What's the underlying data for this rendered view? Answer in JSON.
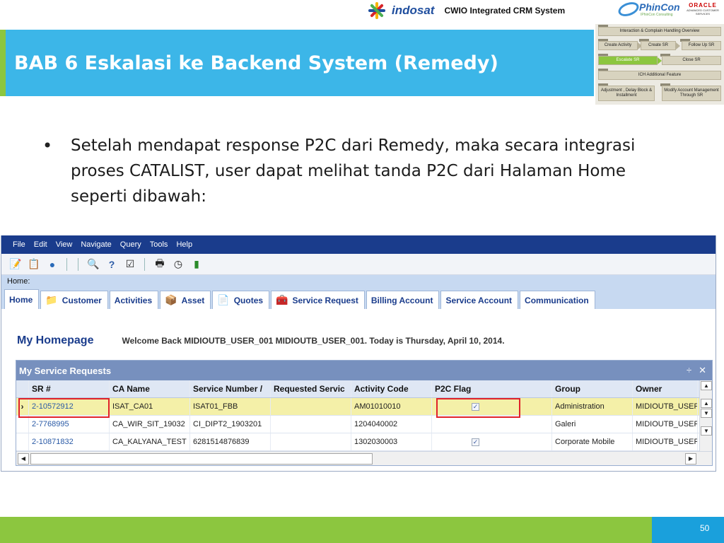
{
  "header": {
    "indosat_label": "indosat",
    "crm_title": "CWIO Integrated CRM System",
    "phincon_label": "PhinCon",
    "phincon_tagline": "IPhinCon Consulting",
    "oracle_label": "ORACLE",
    "oracle_sub": "ADVANCED CUSTOMER SERVICES",
    "accent_green": "#8cc63f",
    "accent_blue": "#3cb6e8"
  },
  "slide_title": "BAB 6 Eskalasi ke Backend System (Remedy)",
  "flow": {
    "items": [
      "Interaction & Complain Handling Overview",
      "Create Activity",
      "Create SR",
      "Follow Up SR",
      "Escalate SR",
      "Close SR",
      "ICH Additional Feature",
      "Adjustment , Delay Block & Installment",
      "Modify Account Management Through SR"
    ]
  },
  "bullet": "Setelah mendapat response P2C dari Remedy, maka secara integrasi proses CATALIST, user dapat melihat tanda P2C dari Halaman Home seperti dibawah:",
  "app": {
    "menu": [
      "File",
      "Edit",
      "View",
      "Navigate",
      "Query",
      "Tools",
      "Help"
    ],
    "home_label": "Home:",
    "tabs": [
      {
        "label": "Home",
        "icon": ""
      },
      {
        "label": "Customer",
        "icon": "folder-icon"
      },
      {
        "label": "Activities",
        "icon": ""
      },
      {
        "label": "Asset",
        "icon": "box-icon"
      },
      {
        "label": "Quotes",
        "icon": "document-icon"
      },
      {
        "label": "Service Request",
        "icon": "toolbox-icon"
      },
      {
        "label": "Billing Account",
        "icon": ""
      },
      {
        "label": "Service Account",
        "icon": ""
      },
      {
        "label": "Communication",
        "icon": ""
      }
    ],
    "homepage_title": "My Homepage",
    "welcome_text": "Welcome Back MIDIOUTB_USER_001 MIDIOUTB_USER_001.  Today is Thursday, April 10, 2014.",
    "panel_title": "My Service Requests",
    "columns": [
      "SR #",
      "CA Name",
      "Service Number / MSISDN",
      "Requested Service",
      "Activity Code",
      "P2C Flag",
      "Group",
      "Owner"
    ],
    "columns_display": [
      "SR #",
      "CA Name",
      "Service Number /",
      "Requested Servic",
      "Activity Code",
      "P2C Flag",
      "Group",
      "Owner"
    ],
    "rows": [
      {
        "sr": "2-10572912",
        "ca": "ISAT_CA01",
        "svc": "ISAT01_FBB",
        "req": "",
        "act": "AM01010010",
        "p2c": true,
        "group": "Administration",
        "owner": "MIDIOUTB_USER"
      },
      {
        "sr": "2-7768995",
        "ca": "CA_WIR_SIT_19032",
        "svc": "CI_DIPT2_1903201",
        "req": "",
        "act": "1204040002",
        "p2c": false,
        "group": "Galeri",
        "owner": "MIDIOUTB_USER"
      },
      {
        "sr": "2-10871832",
        "ca": "CA_KALYANA_TEST",
        "svc": "6281514876839",
        "req": "",
        "act": "1302030003",
        "p2c": true,
        "group": "Corporate Mobile",
        "owner": "MIDIOUTB_USER"
      }
    ],
    "highlight_color": "#e0222a"
  },
  "page_number": "50"
}
